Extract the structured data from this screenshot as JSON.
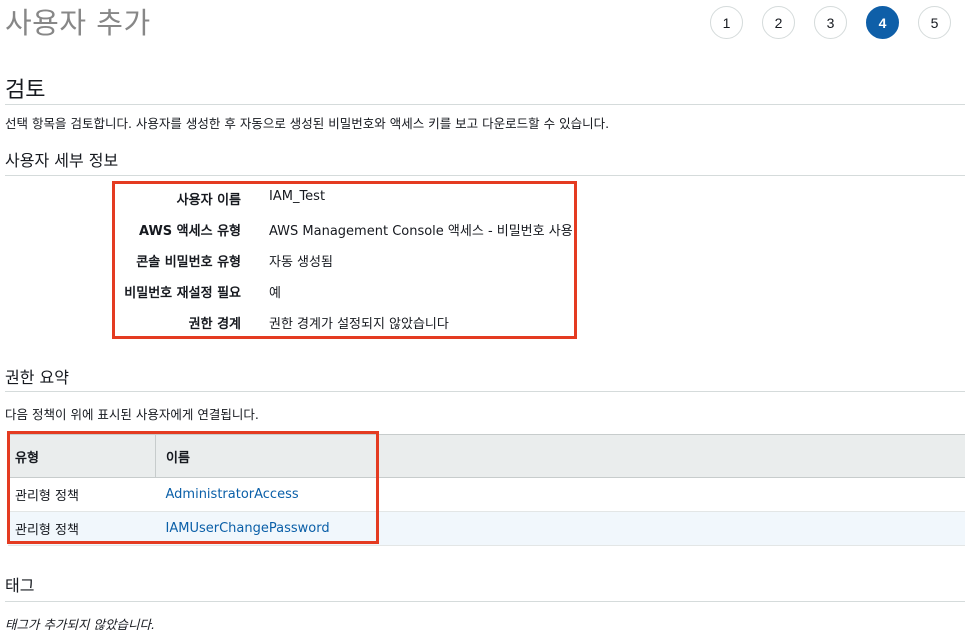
{
  "page": {
    "title": "사용자 추가"
  },
  "steps": [
    "1",
    "2",
    "3",
    "4",
    "5"
  ],
  "active_step": "4",
  "review": {
    "heading": "검토",
    "description": "선택 항목을 검토합니다. 사용자를 생성한 후 자동으로 생성된 비밀번호와 액세스 키를 보고 다운로드할 수 있습니다."
  },
  "user_details": {
    "heading": "사용자 세부 정보",
    "rows": [
      {
        "label": "사용자 이름",
        "value": "IAM_Test"
      },
      {
        "label": "AWS 액세스 유형",
        "value": "AWS Management Console 액세스 - 비밀번호 사용"
      },
      {
        "label": "콘솔 비밀번호 유형",
        "value": "자동 생성됨"
      },
      {
        "label": "비밀번호 재설정 필요",
        "value": "예"
      },
      {
        "label": "권한 경계",
        "value": "권한 경계가 설정되지 않았습니다"
      }
    ]
  },
  "permissions": {
    "heading": "권한 요약",
    "description": "다음 정책이 위에 표시된 사용자에게 연결됩니다.",
    "columns": [
      "유형",
      "이름"
    ],
    "rows": [
      {
        "type": "관리형 정책",
        "name": "AdministratorAccess"
      },
      {
        "type": "관리형 정책",
        "name": "IAMUserChangePassword"
      }
    ]
  },
  "tags": {
    "heading": "태그",
    "description": "태그가 추가되지 않았습니다."
  },
  "colors": {
    "highlight": "#e43b21",
    "active_step": "#0f5fa8",
    "link": "#0a5fa8"
  }
}
